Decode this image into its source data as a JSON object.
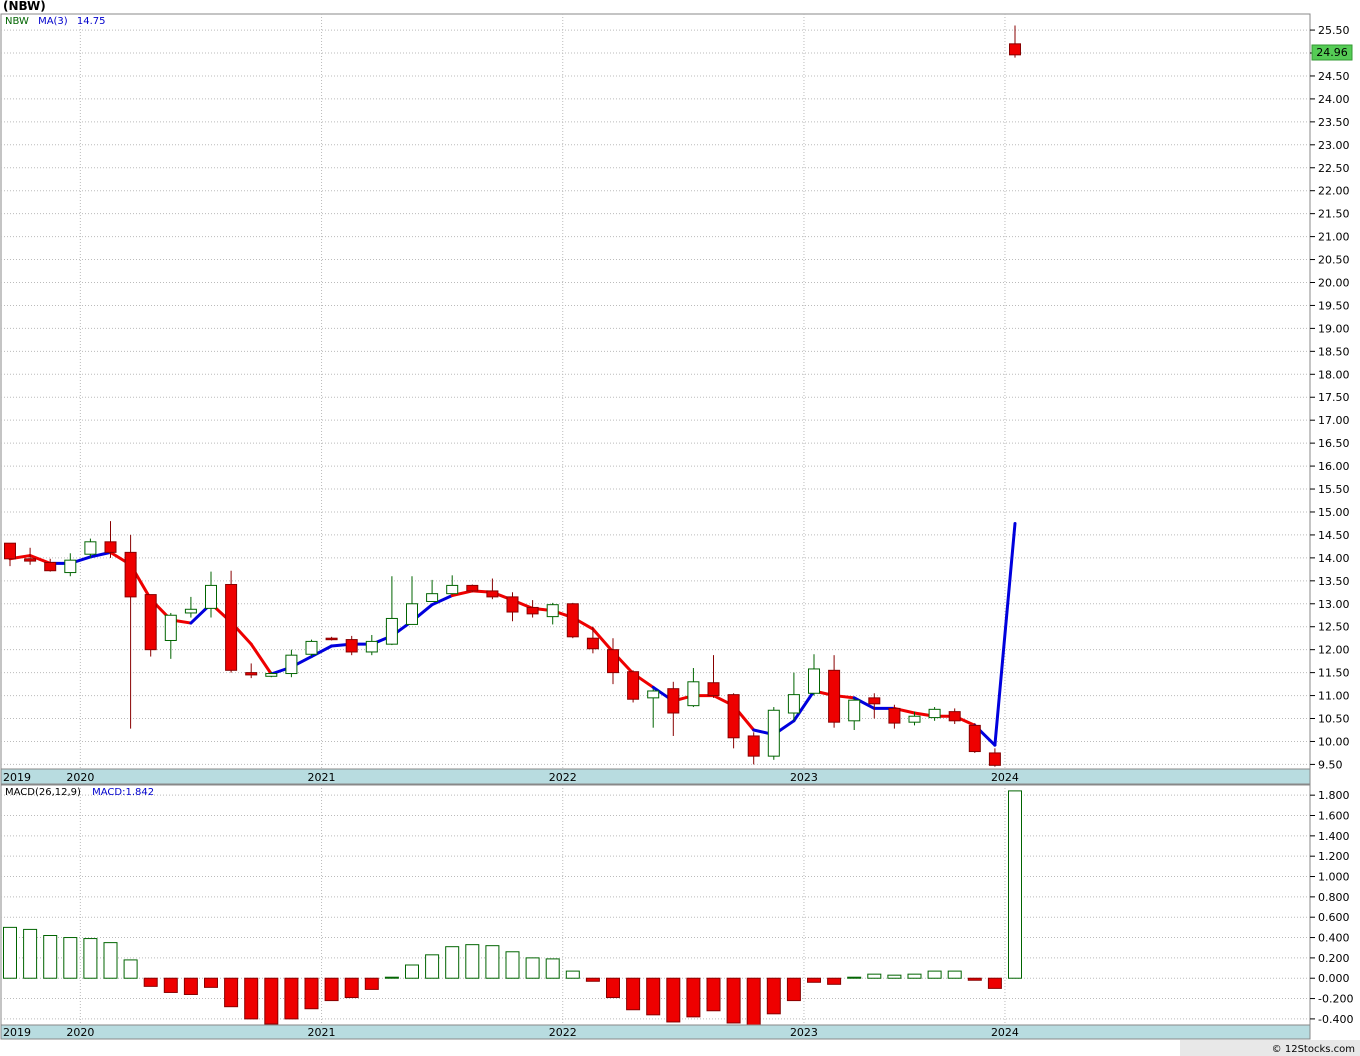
{
  "chart_data": [
    {
      "type": "candlestick",
      "title": "(NBW)",
      "legend": {
        "symbol": "NBW",
        "ma_label": "MA(3)",
        "ma_value": "14.75"
      },
      "last_price_label": "24.96",
      "ylim": [
        9.4,
        25.85
      ],
      "y_ticks": [
        9.5,
        10.0,
        10.5,
        11.0,
        11.5,
        12.0,
        12.5,
        13.0,
        13.5,
        14.0,
        14.5,
        15.0,
        15.5,
        16.0,
        16.5,
        17.0,
        17.5,
        18.0,
        18.5,
        19.0,
        19.5,
        20.0,
        20.5,
        21.0,
        21.5,
        22.0,
        22.5,
        23.0,
        23.5,
        24.0,
        24.5,
        25.0,
        25.5
      ],
      "x_ticks": [
        {
          "label": "2019",
          "index": -0.2
        },
        {
          "label": "2020",
          "index": 4
        },
        {
          "label": "2021",
          "index": 16
        },
        {
          "label": "2022",
          "index": 28
        },
        {
          "label": "2023",
          "index": 40
        },
        {
          "label": "2024",
          "index": 50
        }
      ],
      "candles": [
        {
          "o": 14.32,
          "h": 14.32,
          "l": 13.82,
          "c": 13.98,
          "ma": 13.98,
          "ma_color": "blue"
        },
        {
          "o": 13.98,
          "h": 14.22,
          "l": 13.85,
          "c": 13.93,
          "ma": 14.05,
          "ma_color": "red"
        },
        {
          "o": 13.9,
          "h": 13.98,
          "l": 13.7,
          "c": 13.72,
          "ma": 13.88,
          "ma_color": "red"
        },
        {
          "o": 13.68,
          "h": 14.1,
          "l": 13.6,
          "c": 13.95,
          "ma": 13.88,
          "ma_color": "blue"
        },
        {
          "o": 14.08,
          "h": 14.42,
          "l": 14.0,
          "c": 14.35,
          "ma": 14.02,
          "ma_color": "blue"
        },
        {
          "o": 14.35,
          "h": 14.8,
          "l": 14.0,
          "c": 14.12,
          "ma": 14.12,
          "ma_color": "blue"
        },
        {
          "o": 14.12,
          "h": 14.5,
          "l": 10.28,
          "c": 13.15,
          "ma": 13.85,
          "ma_color": "red"
        },
        {
          "o": 13.2,
          "h": 13.2,
          "l": 11.85,
          "c": 12.0,
          "ma": 13.1,
          "ma_color": "red"
        },
        {
          "o": 12.2,
          "h": 12.8,
          "l": 11.8,
          "c": 12.75,
          "ma": 12.65,
          "ma_color": "red"
        },
        {
          "o": 12.8,
          "h": 13.15,
          "l": 12.7,
          "c": 12.88,
          "ma": 12.58,
          "ma_color": "red"
        },
        {
          "o": 12.9,
          "h": 13.7,
          "l": 12.7,
          "c": 13.4,
          "ma": 13.0,
          "ma_color": "blue"
        },
        {
          "o": 13.42,
          "h": 13.72,
          "l": 11.5,
          "c": 11.55,
          "ma": 12.6,
          "ma_color": "red"
        },
        {
          "o": 11.5,
          "h": 11.7,
          "l": 11.38,
          "c": 11.45,
          "ma": 12.12,
          "ma_color": "red"
        },
        {
          "o": 11.42,
          "h": 11.52,
          "l": 11.4,
          "c": 11.48,
          "ma": 11.47,
          "ma_color": "red"
        },
        {
          "o": 11.48,
          "h": 12.0,
          "l": 11.4,
          "c": 11.88,
          "ma": 11.62,
          "ma_color": "blue"
        },
        {
          "o": 11.9,
          "h": 12.22,
          "l": 11.85,
          "c": 12.18,
          "ma": 11.85,
          "ma_color": "blue"
        },
        {
          "o": 12.25,
          "h": 12.28,
          "l": 12.2,
          "c": 12.22,
          "ma": 12.08,
          "ma_color": "blue"
        },
        {
          "o": 12.22,
          "h": 12.3,
          "l": 11.88,
          "c": 11.95,
          "ma": 12.12,
          "ma_color": "blue"
        },
        {
          "o": 11.95,
          "h": 12.32,
          "l": 11.88,
          "c": 12.18,
          "ma": 12.12,
          "ma_color": "blue"
        },
        {
          "o": 12.12,
          "h": 13.6,
          "l": 12.1,
          "c": 12.68,
          "ma": 12.3,
          "ma_color": "blue"
        },
        {
          "o": 12.55,
          "h": 13.6,
          "l": 12.55,
          "c": 13.0,
          "ma": 12.62,
          "ma_color": "blue"
        },
        {
          "o": 13.05,
          "h": 13.52,
          "l": 13.05,
          "c": 13.22,
          "ma": 12.98,
          "ma_color": "blue"
        },
        {
          "o": 13.22,
          "h": 13.62,
          "l": 13.2,
          "c": 13.4,
          "ma": 13.18,
          "ma_color": "blue"
        },
        {
          "o": 13.4,
          "h": 13.42,
          "l": 13.25,
          "c": 13.28,
          "ma": 13.28,
          "ma_color": "red"
        },
        {
          "o": 13.28,
          "h": 13.55,
          "l": 13.1,
          "c": 13.15,
          "ma": 13.25,
          "ma_color": "red"
        },
        {
          "o": 13.15,
          "h": 13.25,
          "l": 12.62,
          "c": 12.82,
          "ma": 13.08,
          "ma_color": "red"
        },
        {
          "o": 12.92,
          "h": 13.08,
          "l": 12.7,
          "c": 12.78,
          "ma": 12.9,
          "ma_color": "red"
        },
        {
          "o": 12.72,
          "h": 13.02,
          "l": 12.55,
          "c": 12.98,
          "ma": 12.85,
          "ma_color": "red"
        },
        {
          "o": 13.0,
          "h": 13.02,
          "l": 12.25,
          "c": 12.28,
          "ma": 12.7,
          "ma_color": "red"
        },
        {
          "o": 12.25,
          "h": 12.5,
          "l": 11.92,
          "c": 12.02,
          "ma": 12.45,
          "ma_color": "red"
        },
        {
          "o": 12.0,
          "h": 12.25,
          "l": 11.25,
          "c": 11.5,
          "ma": 11.95,
          "ma_color": "red"
        },
        {
          "o": 11.52,
          "h": 11.55,
          "l": 10.85,
          "c": 10.92,
          "ma": 11.48,
          "ma_color": "red"
        },
        {
          "o": 10.95,
          "h": 11.15,
          "l": 10.3,
          "c": 11.1,
          "ma": 11.18,
          "ma_color": "red"
        },
        {
          "o": 11.15,
          "h": 11.3,
          "l": 10.12,
          "c": 10.62,
          "ma": 10.88,
          "ma_color": "blue"
        },
        {
          "o": 10.78,
          "h": 11.6,
          "l": 10.75,
          "c": 11.3,
          "ma": 11.0,
          "ma_color": "red"
        },
        {
          "o": 11.28,
          "h": 11.88,
          "l": 10.95,
          "c": 11.0,
          "ma": 11.0,
          "ma_color": "red"
        },
        {
          "o": 11.02,
          "h": 11.05,
          "l": 9.85,
          "c": 10.08,
          "ma": 10.78,
          "ma_color": "red"
        },
        {
          "o": 10.12,
          "h": 10.2,
          "l": 9.5,
          "c": 9.68,
          "ma": 10.25,
          "ma_color": "red"
        },
        {
          "o": 9.68,
          "h": 10.75,
          "l": 9.6,
          "c": 10.68,
          "ma": 10.15,
          "ma_color": "blue"
        },
        {
          "o": 10.62,
          "h": 11.5,
          "l": 10.45,
          "c": 11.02,
          "ma": 10.45,
          "ma_color": "blue"
        },
        {
          "o": 11.05,
          "h": 11.9,
          "l": 11.0,
          "c": 11.58,
          "ma": 11.1,
          "ma_color": "blue"
        },
        {
          "o": 11.55,
          "h": 11.88,
          "l": 10.3,
          "c": 10.42,
          "ma": 11.0,
          "ma_color": "red"
        },
        {
          "o": 10.45,
          "h": 10.95,
          "l": 10.25,
          "c": 10.9,
          "ma": 10.95,
          "ma_color": "red"
        },
        {
          "o": 10.95,
          "h": 11.05,
          "l": 10.5,
          "c": 10.82,
          "ma": 10.72,
          "ma_color": "blue"
        },
        {
          "o": 10.72,
          "h": 10.8,
          "l": 10.28,
          "c": 10.4,
          "ma": 10.72,
          "ma_color": "blue"
        },
        {
          "o": 10.42,
          "h": 10.65,
          "l": 10.35,
          "c": 10.55,
          "ma": 10.62,
          "ma_color": "red"
        },
        {
          "o": 10.52,
          "h": 10.75,
          "l": 10.45,
          "c": 10.7,
          "ma": 10.55,
          "ma_color": "red"
        },
        {
          "o": 10.65,
          "h": 10.72,
          "l": 10.38,
          "c": 10.45,
          "ma": 10.55,
          "ma_color": "red"
        },
        {
          "o": 10.35,
          "h": 10.4,
          "l": 9.75,
          "c": 9.78,
          "ma": 10.35,
          "ma_color": "red"
        },
        {
          "o": 9.75,
          "h": 9.85,
          "l": 9.45,
          "c": 9.48,
          "ma": 9.92,
          "ma_color": "blue"
        },
        {
          "o": 25.2,
          "h": 25.6,
          "l": 24.9,
          "c": 24.96,
          "ma": 14.75,
          "ma_color": "blue"
        }
      ]
    },
    {
      "type": "bar",
      "title": "MACD(26,12,9)",
      "legend": {
        "label": "MACD(26,12,9)",
        "value_label": "MACD:1.842"
      },
      "ylim": [
        -0.46,
        1.9
      ],
      "y_ticks": [
        -0.4,
        -0.2,
        0.0,
        0.2,
        0.4,
        0.6,
        0.8,
        1.0,
        1.2,
        1.4,
        1.6,
        1.8
      ],
      "x_ticks": [
        {
          "label": "2019",
          "index": -0.2
        },
        {
          "label": "2020",
          "index": 4
        },
        {
          "label": "2021",
          "index": 16
        },
        {
          "label": "2022",
          "index": 28
        },
        {
          "label": "2023",
          "index": 40
        },
        {
          "label": "2024",
          "index": 50
        }
      ],
      "values": [
        0.5,
        0.48,
        0.42,
        0.4,
        0.39,
        0.35,
        0.18,
        -0.08,
        -0.14,
        -0.16,
        -0.09,
        -0.28,
        -0.4,
        -0.45,
        -0.4,
        -0.3,
        -0.22,
        -0.19,
        -0.11,
        0.01,
        0.13,
        0.23,
        0.31,
        0.33,
        0.32,
        0.26,
        0.2,
        0.19,
        0.07,
        -0.03,
        -0.19,
        -0.31,
        -0.36,
        -0.43,
        -0.38,
        -0.32,
        -0.44,
        -0.47,
        -0.35,
        -0.22,
        -0.04,
        -0.06,
        0.01,
        0.04,
        0.03,
        0.04,
        0.07,
        0.07,
        -0.02,
        -0.1,
        1.842
      ]
    }
  ],
  "credit": "© 12Stocks.com"
}
